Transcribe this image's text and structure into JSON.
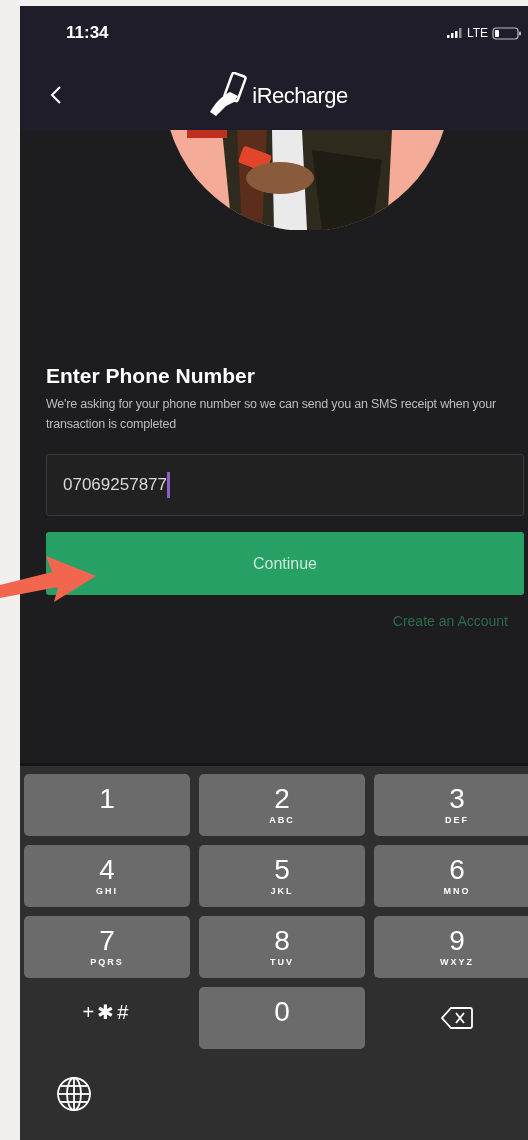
{
  "status_bar": {
    "time": "11:34",
    "network": "LTE"
  },
  "nav_bar": {
    "logo_text": "iRecharge"
  },
  "form": {
    "title": "Enter Phone Number",
    "description": "We're asking for your phone number so we can send you an SMS receipt when your transaction is completed",
    "phone_field": {
      "value": "07069257877",
      "focused": true
    },
    "continue_button": "Continue",
    "create_account_link": "Create an Account"
  },
  "keyboard": {
    "keys": [
      {
        "kind": "digit",
        "digit": "1"
      },
      {
        "kind": "digit",
        "digit": "2",
        "letters": "ABC"
      },
      {
        "kind": "digit",
        "digit": "3",
        "letters": "DEF"
      },
      {
        "kind": "digit",
        "digit": "4",
        "letters": "GHI"
      },
      {
        "kind": "digit",
        "digit": "5",
        "letters": "JKL"
      },
      {
        "kind": "digit",
        "digit": "6",
        "letters": "MNO"
      },
      {
        "kind": "digit",
        "digit": "7",
        "letters": "PQRS"
      },
      {
        "kind": "digit",
        "digit": "8",
        "letters": "TUV"
      },
      {
        "kind": "digit",
        "digit": "9",
        "letters": "WXYZ"
      },
      {
        "kind": "symbols",
        "digit": "+✱#"
      },
      {
        "kind": "digit",
        "digit": "0"
      },
      {
        "kind": "backspace"
      }
    ]
  }
}
